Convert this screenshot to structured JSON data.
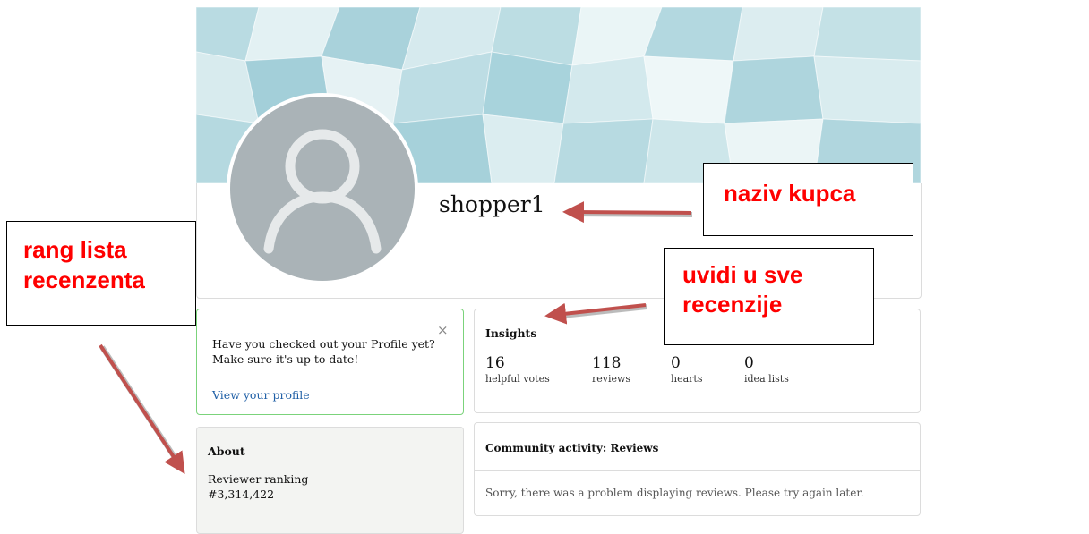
{
  "profile": {
    "username": "shopper1"
  },
  "prompt": {
    "text_line1": "Have you checked out your Profile yet?",
    "text_line2": "Make sure it's up to date!",
    "link": "View your profile",
    "close_glyph": "×"
  },
  "about": {
    "title": "About",
    "ranking_label": "Reviewer ranking",
    "ranking_value": "#3,314,422"
  },
  "insights": {
    "title": "Insights",
    "stats": [
      {
        "value": "16",
        "label": "helpful votes"
      },
      {
        "value": "118",
        "label": "reviews"
      },
      {
        "value": "0",
        "label": "hearts"
      },
      {
        "value": "0",
        "label": "idea lists"
      }
    ]
  },
  "activity": {
    "title": "Community activity: Reviews",
    "message": "Sorry, there was a problem displaying reviews. Please try again later."
  },
  "annotations": {
    "name_callout": "naziv kupca",
    "insights_callout_line1": "uvidi u sve",
    "insights_callout_line2": "recenzije",
    "rank_callout_line1": "rang lista",
    "rank_callout_line2": "recenzenta",
    "text_color": "#ff0000",
    "arrow_color": "#c0504d"
  },
  "colors": {
    "banner": "#cfe6ea",
    "avatar": "#aab3b7",
    "prompt_border": "#7bd37b",
    "link": "#1f5fa6",
    "about_bg": "#f3f4f2"
  },
  "icons": {
    "avatar": "user-silhouette-icon",
    "close": "close-icon"
  }
}
